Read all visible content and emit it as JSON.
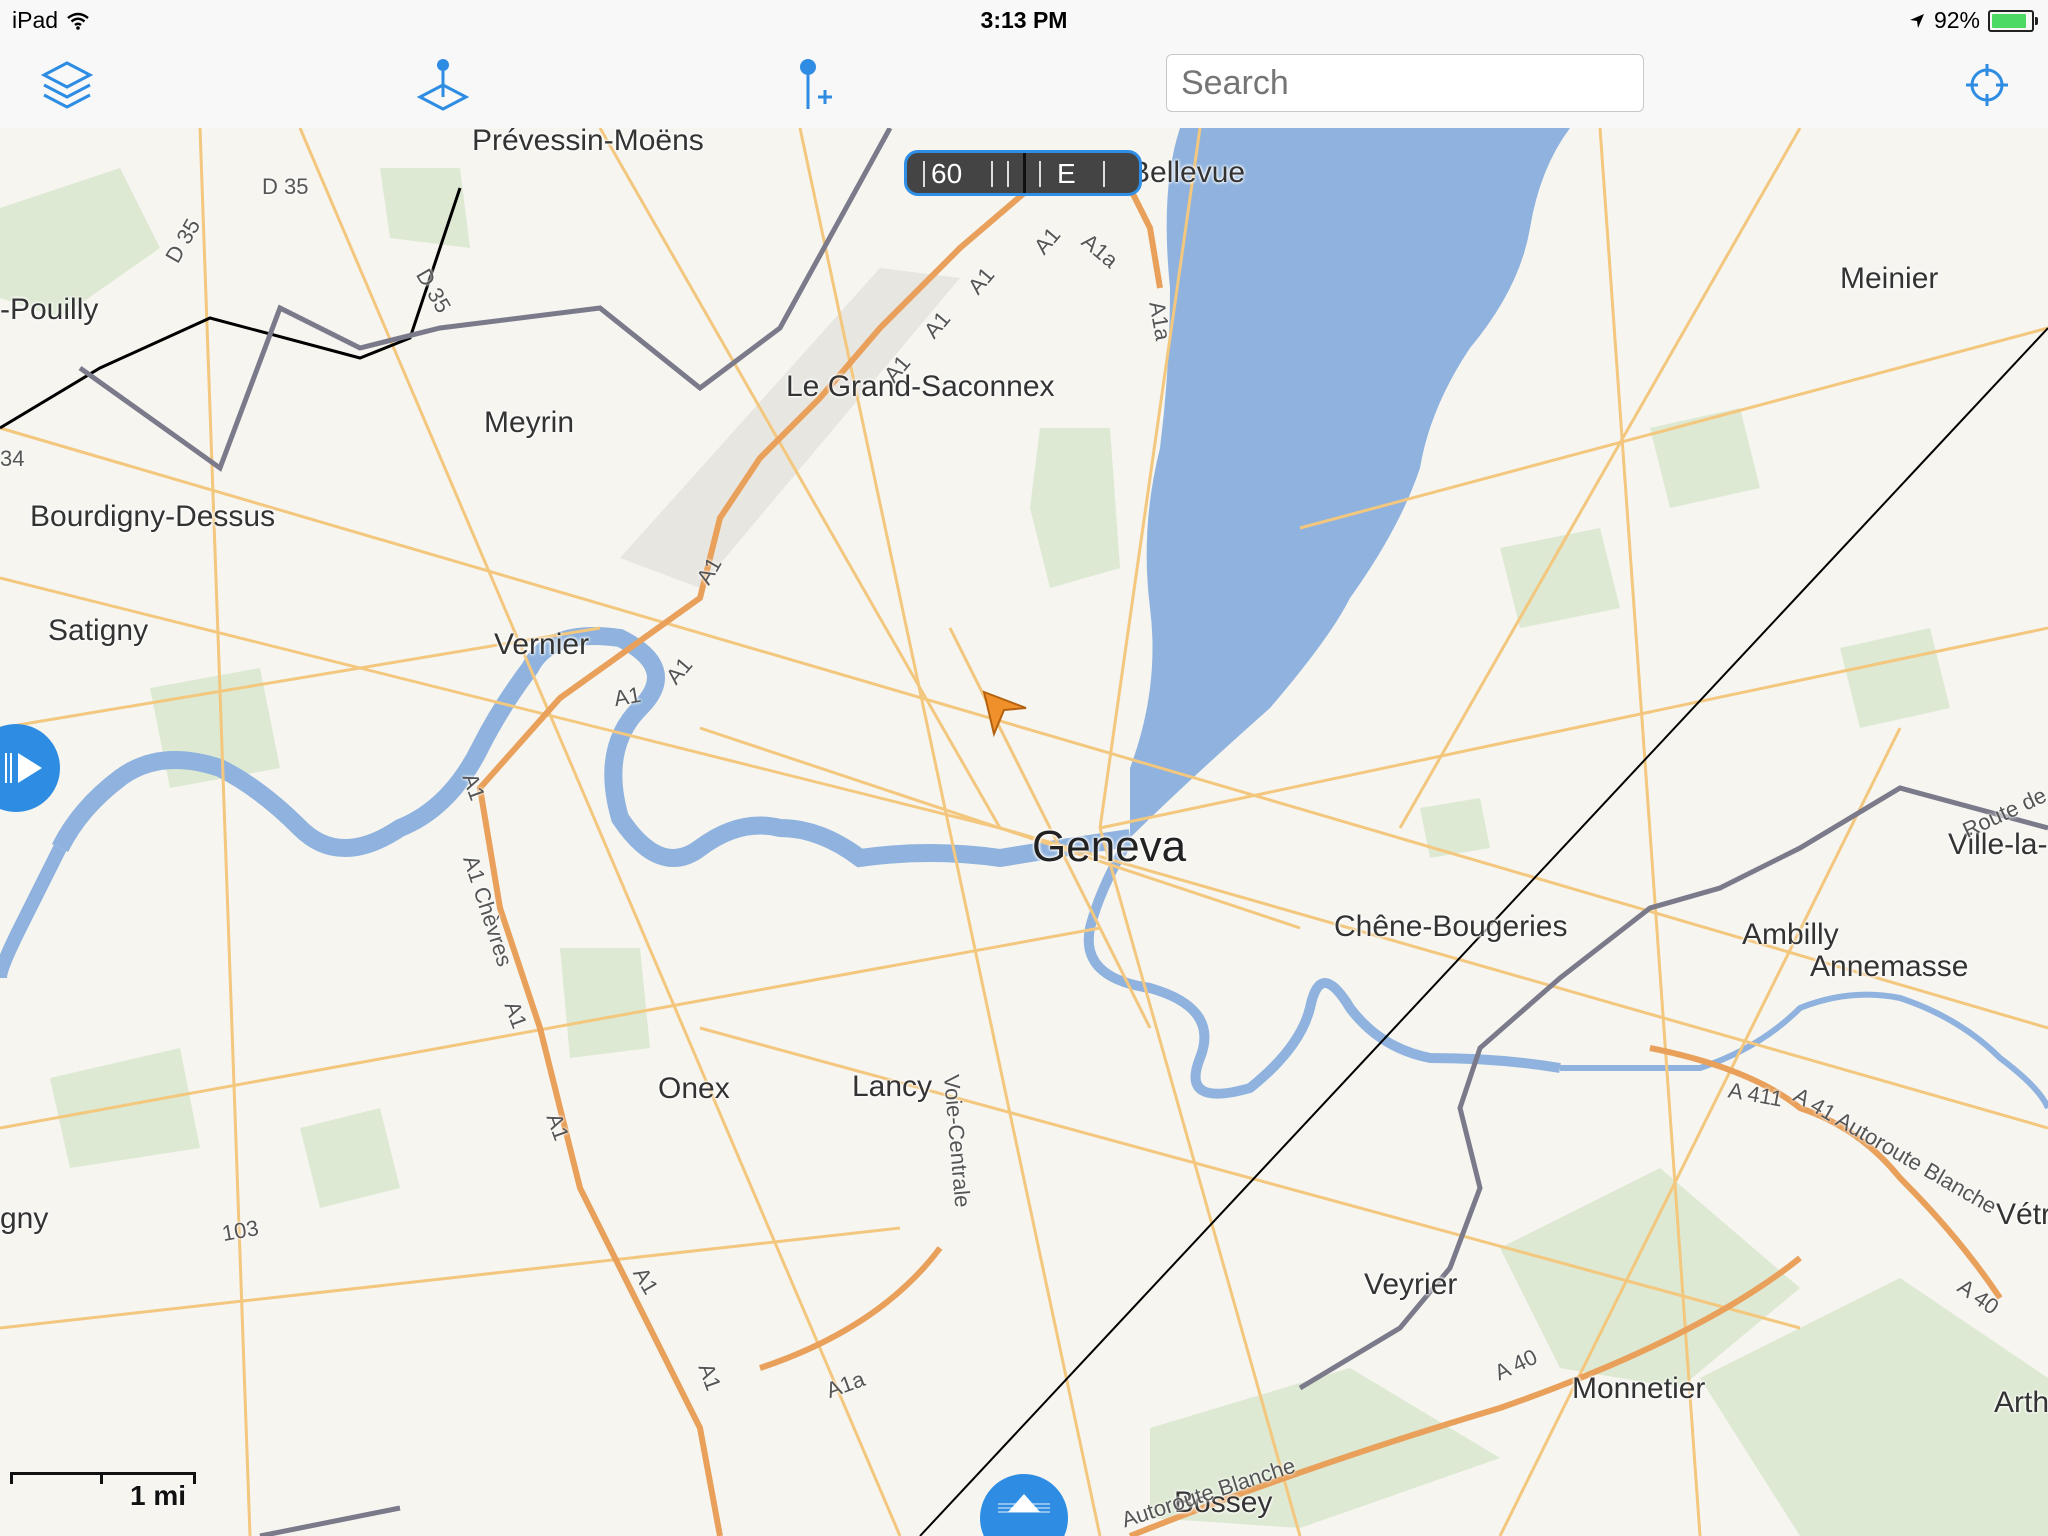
{
  "status_bar": {
    "device": "iPad",
    "time": "3:13 PM",
    "battery": "92%"
  },
  "toolbar": {
    "layers_icon": "layers-icon",
    "map_pin_icon": "map-pin-plane-icon",
    "add_pin_icon": "add-pin-icon",
    "search_placeholder": "Search",
    "locate_icon": "crosshair-icon"
  },
  "hud": {
    "speed": "60",
    "heading": "E"
  },
  "map": {
    "places": {
      "prevessin": "Prévessin-Moëns",
      "bellevue": "Bellevue",
      "pouilly": "-Pouilly",
      "meinier": "Meinier",
      "grand_saconnex": "Le Grand-Saconnex",
      "meyrin": "Meyrin",
      "bourdigny": "Bourdigny-Dessus",
      "satigny": "Satigny",
      "vernier": "Vernier",
      "geneva": "Geneva",
      "chene_bougeries": "Chêne-Bougeries",
      "ville_la": "Ville-la-",
      "ambilly": "Ambilly",
      "annemasse": "Annemasse",
      "onex": "Onex",
      "lancy": "Lancy",
      "gny": "gny",
      "veyrier": "Veyrier",
      "vetr": "Vétr",
      "monnetier": "Monnetier",
      "arth": "Arth",
      "bossey": "Bossey"
    },
    "roads": {
      "d35a": "D 35",
      "d35b": "D 35",
      "d35c": "D 35",
      "a1a": "A1",
      "a1b": "A1",
      "a1c": "A1",
      "a1d": "A1",
      "a1e": "A1",
      "a1f": "A1",
      "a1g": "A1",
      "a1h": "A1",
      "a1i": "A1",
      "a1j": "A1",
      "a1k": "A1",
      "a1l": "A1",
      "a1a_label": "A1a",
      "a1a_label2": "A1a",
      "a1a_label3": "A1a",
      "chevres": "A1 Chèvres",
      "voie_centrale": "Voie-Centrale",
      "r103": "103",
      "a411": "A 411",
      "autoroute_blanche": "A 41 Autoroute Blanche",
      "a40a": "A 40",
      "a40b": "A 40",
      "autoroute_blanche2": "Autoroute Blanche",
      "route_de": "Route de",
      "n34": "34"
    },
    "scale": "1 mi"
  }
}
